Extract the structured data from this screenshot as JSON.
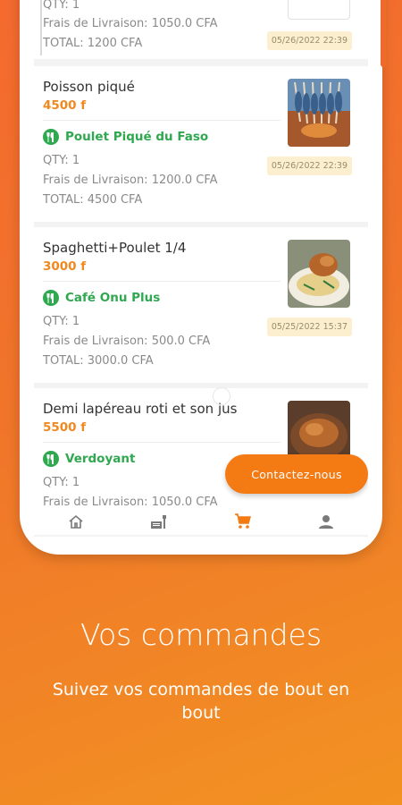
{
  "orders": [
    {
      "qty": "QTY: 1",
      "delivery": "Frais de Livraison: 1050.0 CFA",
      "total": "TOTAL: 1200 CFA",
      "date": "05/26/2022 22:39"
    },
    {
      "name": "Poisson piqué",
      "price": "4500 f",
      "shop": "Poulet Piqué du Faso",
      "qty": "QTY: 1",
      "delivery": "Frais de Livraison: 1200.0 CFA",
      "total": "TOTAL: 4500 CFA",
      "date": "05/26/2022 22:39"
    },
    {
      "name": "Spaghetti+Poulet 1/4",
      "price": "3000 f",
      "shop": "Café Onu Plus",
      "qty": "QTY: 1",
      "delivery": "Frais de Livraison: 500.0 CFA",
      "total": "TOTAL: 3000.0 CFA",
      "date": "05/25/2022 15:37"
    },
    {
      "name": "Demi  lapéreau roti et son jus",
      "price": "5500 f",
      "shop": "Verdoyant",
      "qty": "QTY: 1",
      "delivery": "Frais de Livraison: 1050.0 CFA"
    }
  ],
  "contact_button": "Contactez-nous",
  "nav": {
    "items": [
      "home-icon",
      "menu-icon",
      "cart-icon",
      "profile-icon"
    ],
    "active": "cart-icon",
    "active_color": "#f47a14",
    "inactive_color": "#7a7a7a"
  },
  "caption": {
    "title": "Vos commandes",
    "subtitle": "Suivez vos commandes de bout en bout"
  },
  "colors": {
    "accent": "#f47a14",
    "shop_green": "#2fa84f",
    "price_orange": "#f0891f"
  }
}
